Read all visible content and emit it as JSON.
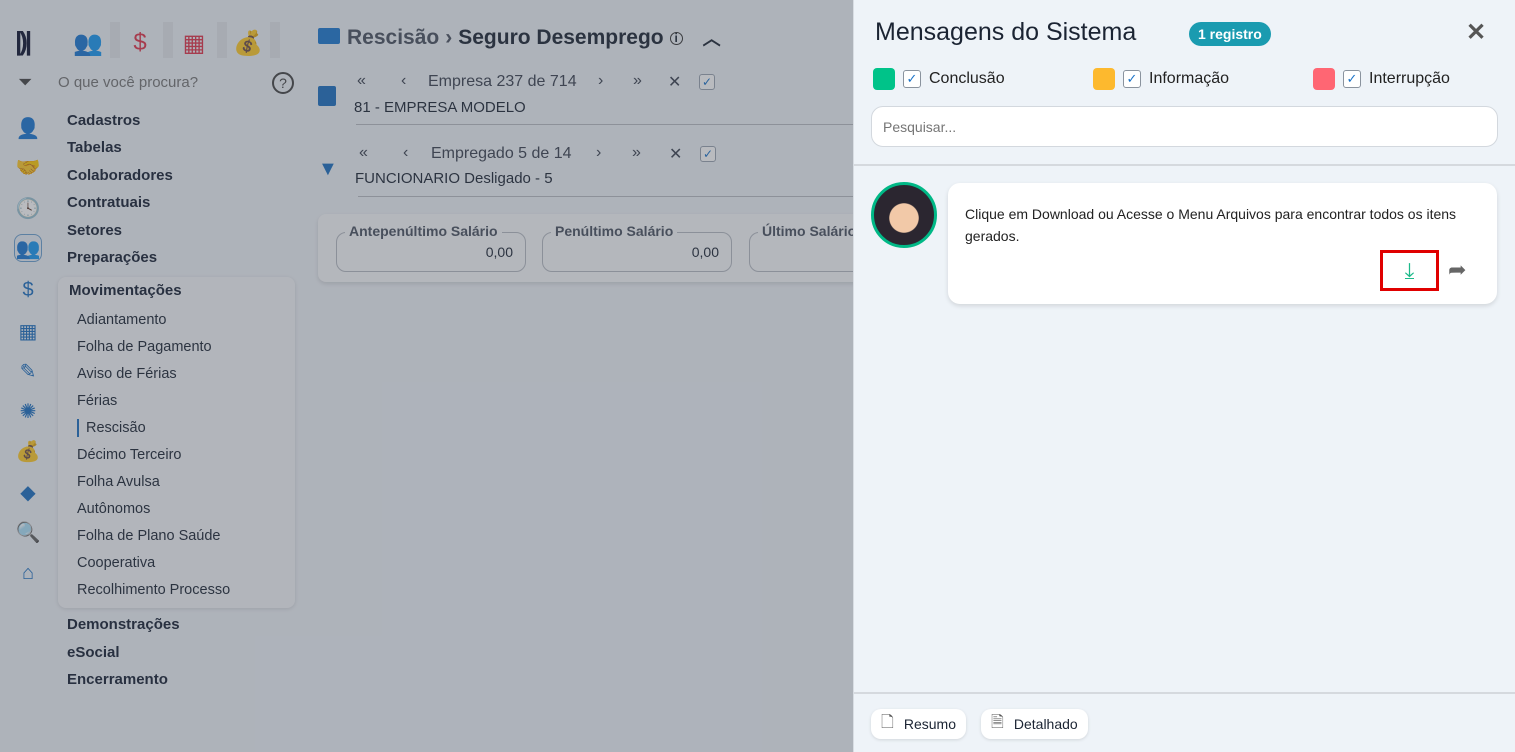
{
  "sidebar": {
    "search_placeholder": "O que você procura?",
    "menu": [
      "Cadastros",
      "Tabelas",
      "Colaboradores",
      "Contratuais",
      "Setores",
      "Preparações"
    ],
    "section": "Movimentações",
    "sub_items": [
      "Adiantamento",
      "Folha de Pagamento",
      "Aviso de Férias",
      "Férias",
      "Rescisão",
      "Décimo Terceiro",
      "Folha Avulsa",
      "Autônomos",
      "Folha de Plano Saúde",
      "Cooperativa",
      "Recolhimento Processo"
    ],
    "active_sub": "Rescisão",
    "menu_after": [
      "Demonstrações",
      "eSocial",
      "Encerramento"
    ]
  },
  "header": {
    "breadcrumb_parent": "Rescisão",
    "separator": "›",
    "title": "Seguro Desemprego"
  },
  "empresa": {
    "label": "Empresa",
    "current": "237",
    "of": "de",
    "total": "714",
    "value": "81 - EMPRESA MODELO"
  },
  "empregado": {
    "label": "Empregado 5 de 14",
    "value": "FUNCIONARIO Desligado - 5"
  },
  "fields": [
    {
      "label": "Antepenúltimo Salário",
      "value": "0,00"
    },
    {
      "label": "Penúltimo Salário",
      "value": "0,00"
    },
    {
      "label": "Último Salário",
      "value": ""
    }
  ],
  "panel": {
    "title": "Mensagens do Sistema",
    "badge": "1 registro",
    "close": "✕",
    "legend": [
      {
        "label": "Conclusão",
        "color": "#00c389"
      },
      {
        "label": "Informação",
        "color": "#fdb92e"
      },
      {
        "label": "Interrupção",
        "color": "#ff6673"
      }
    ],
    "search_placeholder": "Pesquisar...",
    "message": "Clique em Download ou Acesse o Menu Arquivos para encontrar todos os itens gerados.",
    "footer": [
      "Resumo",
      "Detalhado"
    ]
  }
}
